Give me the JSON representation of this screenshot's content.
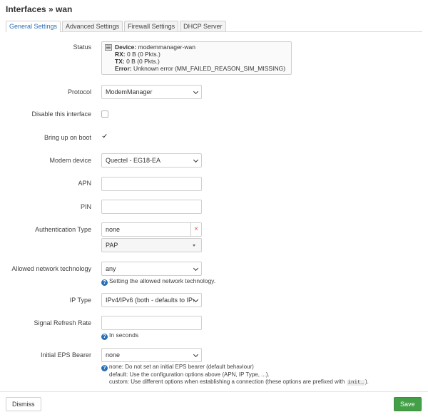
{
  "page": {
    "title": "Interfaces » wan"
  },
  "tabs": [
    {
      "label": "General Settings",
      "active": true
    },
    {
      "label": "Advanced Settings"
    },
    {
      "label": "Firewall Settings"
    },
    {
      "label": "DHCP Server"
    }
  ],
  "status": {
    "label": "Status",
    "device_key": "Device:",
    "device_value": "modemmanager-wan",
    "rx_key": "RX:",
    "rx_value": "0 B (0 Pkts.)",
    "tx_key": "TX:",
    "tx_value": "0 B (0 Pkts.)",
    "error_key": "Error:",
    "error_value": "Unknown error (MM_FAILED_REASON_SIM_MISSING)"
  },
  "protocol": {
    "label": "Protocol",
    "value": "ModemManager"
  },
  "disable_interface": {
    "label": "Disable this interface",
    "checked": false
  },
  "bring_up_on_boot": {
    "label": "Bring up on boot",
    "checked": true
  },
  "modem_device": {
    "label": "Modem device",
    "value": "Quectel - EG18-EA"
  },
  "apn": {
    "label": "APN",
    "value": ""
  },
  "pin": {
    "label": "PIN",
    "value": ""
  },
  "auth_type": {
    "label": "Authentication Type",
    "value": "none",
    "remove_symbol": "×",
    "add_option": "PAP"
  },
  "network_tech": {
    "label": "Allowed network technology",
    "value": "any",
    "hint": "Setting the allowed network technology."
  },
  "ip_type": {
    "label": "IP Type",
    "value": "IPv4/IPv6 (both - defaults to IPv"
  },
  "signal_refresh": {
    "label": "Signal Refresh Rate",
    "value": "",
    "hint": "In seconds"
  },
  "eps_bearer": {
    "label": "Initial EPS Bearer",
    "value": "none",
    "hint_line1": "none: Do not set an initial EPS bearer (default behaviour)",
    "hint_line2": "default: Use the configuration options above (APN, IP Type, ...).",
    "hint_line3_prefix": "custom: Use different options when establishing a connection (these options are prefixed with",
    "hint_code": "init_",
    "hint_line3_suffix": ")."
  },
  "hint_icon_glyph": "?",
  "buttons": {
    "dismiss": "Dismiss",
    "save": "Save"
  },
  "colors": {
    "accent": "#2a6fb4",
    "save": "#43a047",
    "remove": "#d9534f"
  }
}
